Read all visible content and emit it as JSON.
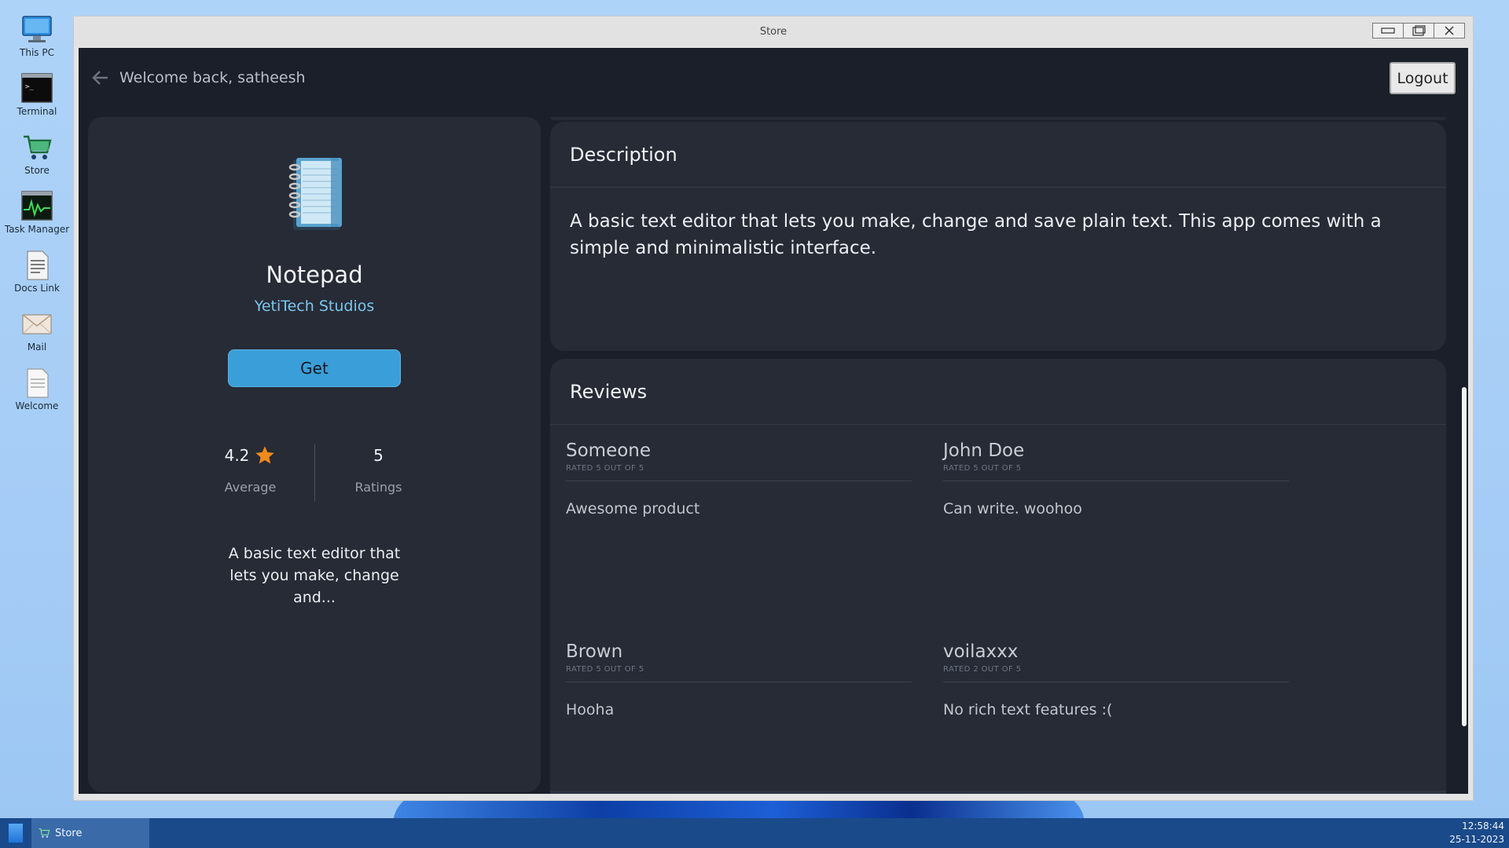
{
  "desktop": {
    "icons": [
      {
        "label": "This PC",
        "icon": "monitor-icon"
      },
      {
        "label": "Terminal",
        "icon": "terminal-icon"
      },
      {
        "label": "Store",
        "icon": "cart-icon"
      },
      {
        "label": "Task Manager",
        "icon": "activity-monitor-icon"
      },
      {
        "label": "Docs Link",
        "icon": "document-icon"
      },
      {
        "label": "Mail",
        "icon": "envelope-icon"
      },
      {
        "label": "Welcome",
        "icon": "page-icon"
      }
    ]
  },
  "window": {
    "title": "Store"
  },
  "header": {
    "welcome": "Welcome back, satheesh",
    "logout_label": "Logout"
  },
  "app": {
    "name": "Notepad",
    "publisher": "YetiTech Studios",
    "get_label": "Get",
    "rating_value": "4.2",
    "rating_caption": "Average",
    "ratings_count": "5",
    "ratings_caption": "Ratings",
    "short_description": "A basic text editor that lets you make, change and...",
    "icon": "notebook-icon"
  },
  "description": {
    "title": "Description",
    "text": "A basic text editor that lets you make, change and save plain text. This app comes with a simple and minimalistic interface."
  },
  "reviews": {
    "title": "Reviews",
    "items": [
      {
        "author": "Someone",
        "rated": "RATED 5 OUT OF 5",
        "text": "Awesome product"
      },
      {
        "author": "John Doe",
        "rated": "RATED 5 OUT OF 5",
        "text": "Can write. woohoo"
      },
      {
        "author": "Brown",
        "rated": "RATED 5 OUT OF 5",
        "text": "Hooha"
      },
      {
        "author": "voilaxxx",
        "rated": "RATED 2 OUT OF 5",
        "text": "No rich text features :("
      }
    ]
  },
  "taskbar": {
    "task_label": "Store",
    "time": "12:58:44",
    "date": "25-11-2023"
  },
  "colors": {
    "app_bg": "#1b1f29",
    "card_bg": "#262b36",
    "accent": "#3a9fd8",
    "publisher": "#7cc6ec",
    "star": "#f08a1c"
  }
}
